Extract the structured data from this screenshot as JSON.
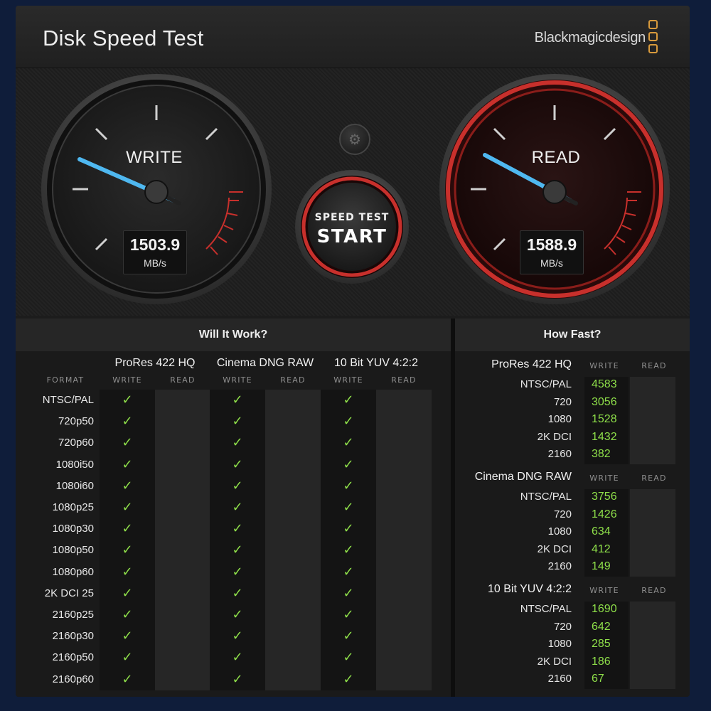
{
  "window": {
    "close_label": "×"
  },
  "titlebar": {
    "title": "Disk Speed Test",
    "brand": "Blackmagicdesign"
  },
  "gauges": {
    "write": {
      "label": "WRITE",
      "value": "1503.9",
      "unit": "MB/s"
    },
    "read": {
      "label": "READ",
      "value": "1588.9",
      "unit": "MB/s"
    }
  },
  "start_button": {
    "top_label": "SPEED TEST",
    "main_label": "START"
  },
  "icons": {
    "settings": "gear-icon",
    "check": "✓"
  },
  "colors": {
    "accent_red": "#c8302c",
    "needle_blue": "#4fb8f0",
    "ok_green": "#8fe04a",
    "brand_orange": "#d89a3c"
  },
  "will_it_work": {
    "title": "Will It Work?",
    "format_label": "FORMAT",
    "write_label": "WRITE",
    "read_label": "READ",
    "codecs": [
      "ProRes 422 HQ",
      "Cinema DNG RAW",
      "10 Bit YUV 4:2:2"
    ],
    "formats": [
      "NTSC/PAL",
      "720p50",
      "720p60",
      "1080i50",
      "1080i60",
      "1080p25",
      "1080p30",
      "1080p50",
      "1080p60",
      "2K DCI 25",
      "2160p25",
      "2160p30",
      "2160p50",
      "2160p60"
    ],
    "write_ok": [
      true,
      true,
      true,
      true,
      true,
      true,
      true,
      true,
      true,
      true,
      true,
      true,
      true,
      true
    ],
    "read_ok": [
      false,
      false,
      false,
      false,
      false,
      false,
      false,
      false,
      false,
      false,
      false,
      false,
      false,
      false
    ]
  },
  "how_fast": {
    "title": "How Fast?",
    "write_label": "WRITE",
    "read_label": "READ",
    "groups": [
      {
        "codec": "ProRes 422 HQ",
        "rows": [
          {
            "res": "NTSC/PAL",
            "write": "4583",
            "read": ""
          },
          {
            "res": "720",
            "write": "3056",
            "read": ""
          },
          {
            "res": "1080",
            "write": "1528",
            "read": ""
          },
          {
            "res": "2K DCI",
            "write": "1432",
            "read": ""
          },
          {
            "res": "2160",
            "write": "382",
            "read": ""
          }
        ]
      },
      {
        "codec": "Cinema DNG RAW",
        "rows": [
          {
            "res": "NTSC/PAL",
            "write": "3756",
            "read": ""
          },
          {
            "res": "720",
            "write": "1426",
            "read": ""
          },
          {
            "res": "1080",
            "write": "634",
            "read": ""
          },
          {
            "res": "2K DCI",
            "write": "412",
            "read": ""
          },
          {
            "res": "2160",
            "write": "149",
            "read": ""
          }
        ]
      },
      {
        "codec": "10 Bit YUV 4:2:2",
        "rows": [
          {
            "res": "NTSC/PAL",
            "write": "1690",
            "read": ""
          },
          {
            "res": "720",
            "write": "642",
            "read": ""
          },
          {
            "res": "1080",
            "write": "285",
            "read": ""
          },
          {
            "res": "2K DCI",
            "write": "186",
            "read": ""
          },
          {
            "res": "2160",
            "write": "67",
            "read": ""
          }
        ]
      }
    ]
  }
}
